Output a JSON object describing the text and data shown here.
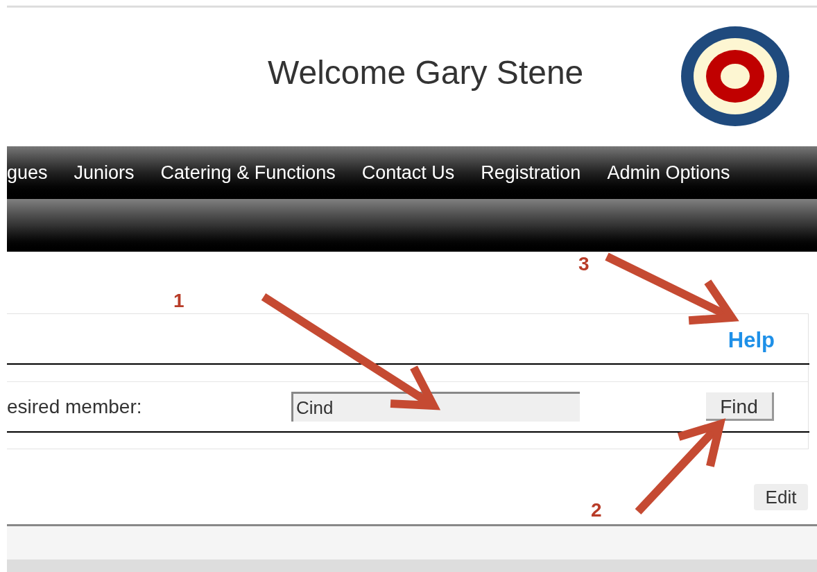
{
  "header": {
    "title": "Welcome Gary Stene"
  },
  "nav": {
    "items": [
      {
        "label": "gues"
      },
      {
        "label": "Juniors"
      },
      {
        "label": "Catering & Functions"
      },
      {
        "label": "Contact Us"
      },
      {
        "label": "Registration"
      },
      {
        "label": "Admin Options"
      }
    ]
  },
  "search_panel": {
    "help_link": "Help",
    "label": "esired member:",
    "field_value": "Cind",
    "button": "Find"
  },
  "edit_button": "Edit",
  "annotations": [
    {
      "number": "1"
    },
    {
      "number": "2"
    },
    {
      "number": "3"
    }
  ]
}
